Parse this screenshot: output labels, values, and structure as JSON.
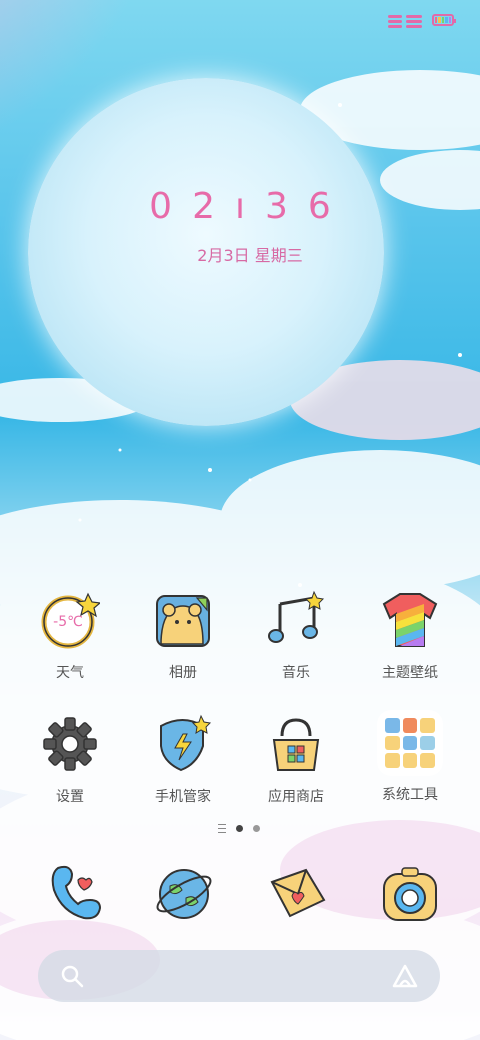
{
  "status": {
    "signal_icon": "signal-icon",
    "battery_icon": "battery-icon"
  },
  "lockclock": {
    "hour": "02",
    "sep": "ı",
    "minute": "36",
    "date": "2月3日 星期三"
  },
  "apps": [
    {
      "label": "天气",
      "icon": "weather-icon",
      "temp": "-5℃"
    },
    {
      "label": "相册",
      "icon": "gallery-icon"
    },
    {
      "label": "音乐",
      "icon": "music-icon"
    },
    {
      "label": "主题壁纸",
      "icon": "theme-icon"
    },
    {
      "label": "设置",
      "icon": "settings-gear-icon"
    },
    {
      "label": "手机管家",
      "icon": "phone-manager-icon"
    },
    {
      "label": "应用商店",
      "icon": "app-store-icon"
    },
    {
      "label": "系统工具",
      "icon": "system-tools-folder-icon"
    }
  ],
  "page_indicator": {
    "pages": 2,
    "active": 1
  },
  "dock": [
    {
      "icon": "phone-icon"
    },
    {
      "icon": "browser-planet-icon"
    },
    {
      "icon": "messages-envelope-icon"
    },
    {
      "icon": "camera-icon"
    }
  ],
  "search": {
    "search_icon": "search-icon",
    "assistant_icon": "assistant-icon"
  },
  "colors": {
    "accent": "#e76ba9",
    "label": "#555555"
  }
}
